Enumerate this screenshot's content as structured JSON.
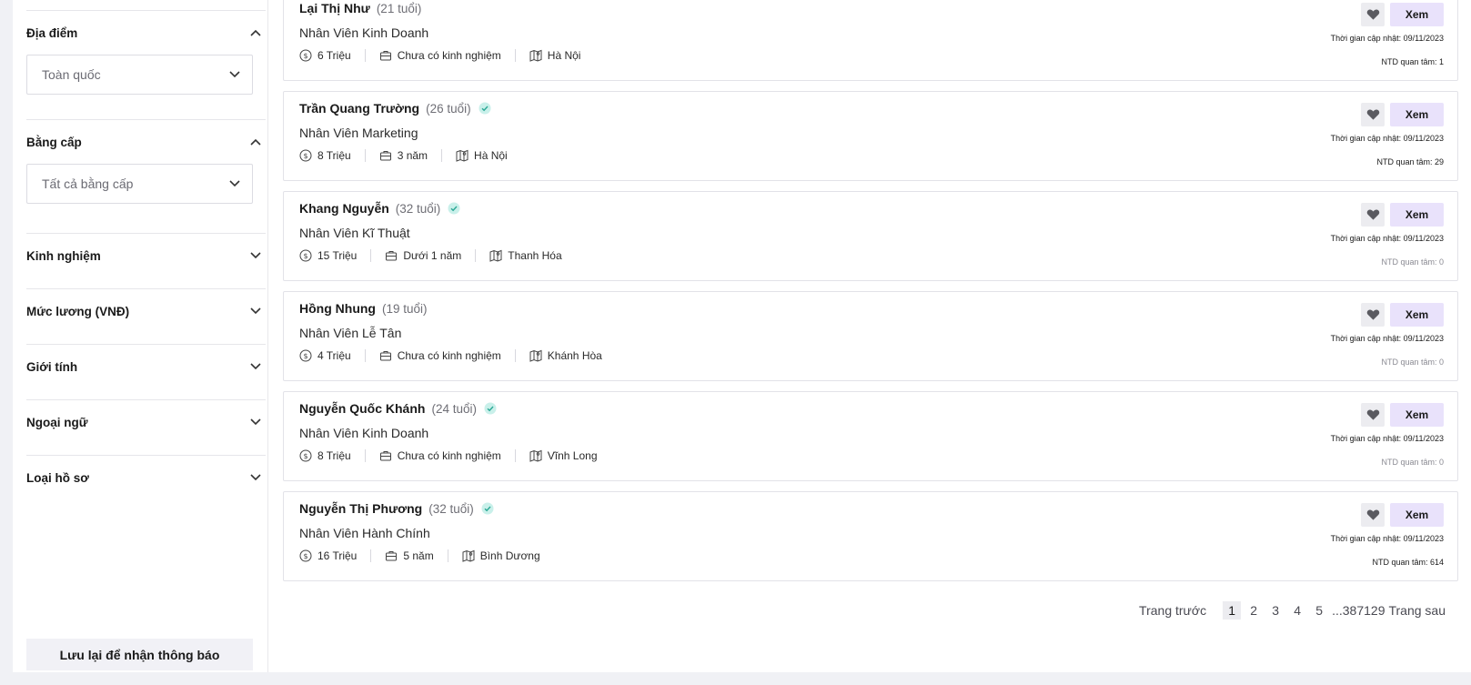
{
  "filters": [
    {
      "title": "Địa điểm",
      "expanded": true,
      "value": "Toàn quốc"
    },
    {
      "title": "Bằng cấp",
      "expanded": true,
      "value": "Tất cả bằng cấp"
    },
    {
      "title": "Kinh nghiệm",
      "expanded": false
    },
    {
      "title": "Mức lương (VNĐ)",
      "expanded": false
    },
    {
      "title": "Giới tính",
      "expanded": false
    },
    {
      "title": "Ngoại ngữ",
      "expanded": false
    },
    {
      "title": "Loại hồ sơ",
      "expanded": false
    }
  ],
  "save_button": "Lưu lại để nhận thông báo",
  "view_label": "Xem",
  "candidates": [
    {
      "name": "Lại Thị Như",
      "age": "(21 tuổi)",
      "verified": false,
      "job": "Nhân Viên Kinh Doanh",
      "salary": "6 Triệu",
      "experience": "Chưa có kinh nghiệm",
      "location": "Hà Nội",
      "updated": "Thời gian cập nhật: 09/11/2023",
      "interest": "NTD quan tâm: 1",
      "interest_dark": true
    },
    {
      "name": "Trần Quang Trường",
      "age": "(26 tuổi)",
      "verified": true,
      "job": "Nhân Viên Marketing",
      "salary": "8 Triệu",
      "experience": "3 năm",
      "location": "Hà Nội",
      "updated": "Thời gian cập nhật: 09/11/2023",
      "interest": "NTD quan tâm: 29",
      "interest_dark": true
    },
    {
      "name": "Khang Nguyễn",
      "age": "(32 tuổi)",
      "verified": true,
      "job": "Nhân Viên Kĩ Thuật",
      "salary": "15 Triệu",
      "experience": "Dưới 1 năm",
      "location": "Thanh Hóa",
      "updated": "Thời gian cập nhật: 09/11/2023",
      "interest": "NTD quan tâm: 0",
      "interest_dark": false
    },
    {
      "name": "Hồng Nhung",
      "age": "(19 tuổi)",
      "verified": false,
      "job": "Nhân Viên Lễ Tân",
      "salary": "4 Triệu",
      "experience": "Chưa có kinh nghiệm",
      "location": "Khánh Hòa",
      "updated": "Thời gian cập nhật: 09/11/2023",
      "interest": "NTD quan tâm: 0",
      "interest_dark": false
    },
    {
      "name": "Nguyễn Quốc Khánh",
      "age": "(24 tuổi)",
      "verified": true,
      "job": "Nhân Viên Kinh Doanh",
      "salary": "8 Triệu",
      "experience": "Chưa có kinh nghiệm",
      "location": "Vĩnh Long",
      "updated": "Thời gian cập nhật: 09/11/2023",
      "interest": "NTD quan tâm: 0",
      "interest_dark": false
    },
    {
      "name": "Nguyễn Thị Phương",
      "age": "(32 tuổi)",
      "verified": true,
      "job": "Nhân Viên Hành Chính",
      "salary": "16 Triệu",
      "experience": "5 năm",
      "location": "Bình Dương",
      "updated": "Thời gian cập nhật: 09/11/2023",
      "interest": "NTD quan tâm: 614",
      "interest_dark": true
    }
  ],
  "pagination": {
    "prev": "Trang trước",
    "pages": [
      "1",
      "2",
      "3",
      "4",
      "5"
    ],
    "current": "1",
    "gap": "...387129",
    "next": "Trang sau"
  },
  "colors": {
    "accent_button": "#e9e2fb",
    "verified_badge": "#c9f0ea",
    "page_background": "#f0f1f5"
  }
}
